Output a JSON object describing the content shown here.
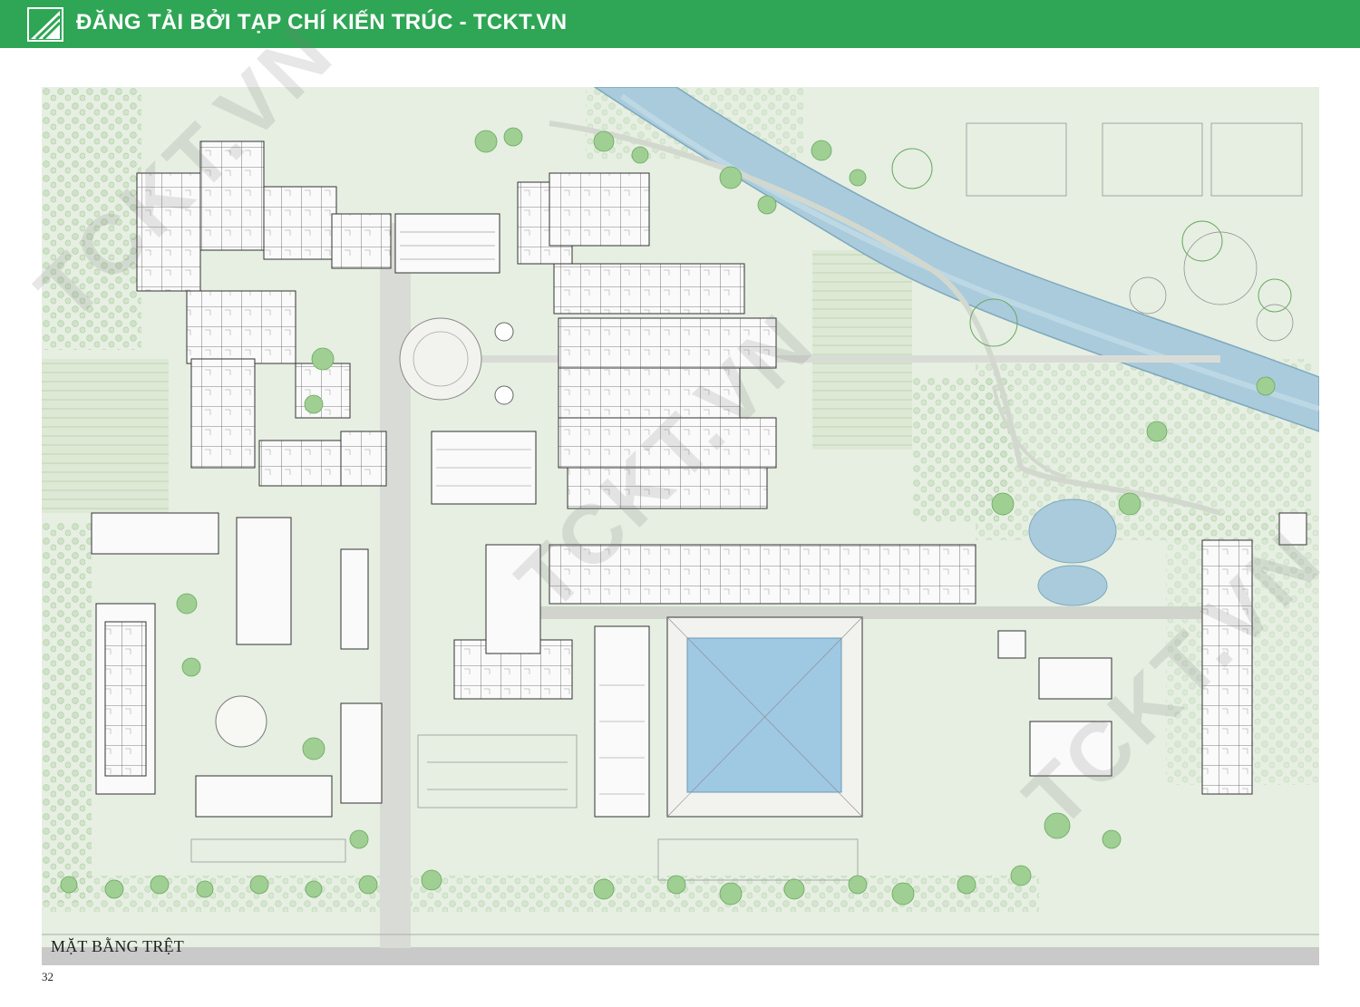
{
  "banner": {
    "text": "ĐĂNG TẢI BỞI TẠP CHÍ KIẾN TRÚC - TCKT.VN",
    "color": "#2ea655",
    "logo_icon": "tckt-logo-icon"
  },
  "plan": {
    "title": "MẶT BẰNG TRỆT",
    "watermark": "TCKT.VN",
    "colors": {
      "ground": "#e6efe2",
      "water": "#a9cbdc",
      "trees": "#7fbf7a",
      "buildings": "#fafafa"
    }
  },
  "page": {
    "number": "32"
  }
}
